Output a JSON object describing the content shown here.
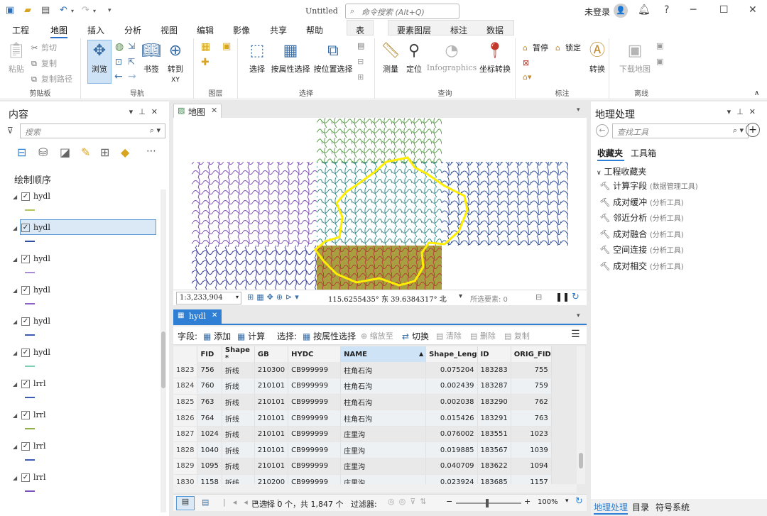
{
  "titlebar": {
    "doc_title": "Untitled",
    "search_placeholder": "命令搜索 (Alt+Q)",
    "login": "未登录",
    "avatar_glyph": "👤"
  },
  "ribbon_tabs": [
    "工程",
    "地图",
    "插入",
    "分析",
    "视图",
    "编辑",
    "影像",
    "共享",
    "帮助",
    "表",
    "要素图层",
    "标注",
    "数据"
  ],
  "ribbon": {
    "clipboard": {
      "paste": "粘贴",
      "cut": "剪切",
      "copy": "复制",
      "copy_path": "复制路径",
      "label": "剪贴板"
    },
    "navigate": {
      "explore": "浏览",
      "bookmarks": "书签",
      "goto": "转到",
      "goto_sub": "XY",
      "label": "导航"
    },
    "layer": {
      "label": "图层"
    },
    "selection": {
      "select": "选择",
      "by_attr": "按属性选择",
      "by_loc": "按位置选择",
      "label": "选择"
    },
    "inquiry": {
      "measure": "测量",
      "locate": "定位",
      "infographics": "Infographics",
      "coord": "坐标转换",
      "label": "查询"
    },
    "labeling": {
      "pause": "暂停",
      "lock": "锁定",
      "convert": "转换",
      "label": "标注"
    },
    "offline": {
      "download": "下载地图",
      "label": "离线"
    }
  },
  "contents": {
    "title": "内容",
    "search_placeholder": "搜索",
    "draw_order": "绘制顺序",
    "layers": [
      {
        "name": "hydl",
        "color": "#b5c45a",
        "selected": false
      },
      {
        "name": "hydl",
        "color": "#2e4fa0",
        "selected": true
      },
      {
        "name": "hydl",
        "color": "#a98ad4",
        "selected": false
      },
      {
        "name": "hydl",
        "color": "#8e63c9",
        "selected": false
      },
      {
        "name": "hydl",
        "color": "#3b5bb5",
        "selected": false
      },
      {
        "name": "hydl",
        "color": "#7fd0b3",
        "selected": false
      },
      {
        "name": "lrrl",
        "color": "#3b5bb5",
        "selected": false
      },
      {
        "name": "lrrl",
        "color": "#8fb04a",
        "selected": false
      },
      {
        "name": "lrrl",
        "color": "#3b5bb5",
        "selected": false
      },
      {
        "name": "lrrl",
        "color": "#7a52c0",
        "selected": false
      }
    ]
  },
  "map": {
    "tab": "地图",
    "scale": "1:3,233,904",
    "coords": "115.6255435° 东 39.6384317° 北",
    "selected_features": "所选要素: 0"
  },
  "table": {
    "tab": "hydl",
    "field_label": "字段:",
    "add": "添加",
    "calculate": "计算",
    "selection_label": "选择:",
    "select_by_attr": "按属性选择",
    "zoom_to": "缩放至",
    "switch": "切换",
    "clear": "清除",
    "delete": "删除",
    "copy": "复制",
    "columns": [
      "FID",
      "Shape *",
      "GB",
      "HYDC",
      "NAME",
      "Shape_Leng",
      "ID",
      "ORIG_FID"
    ],
    "rows": [
      [
        "1823",
        "756",
        "折线",
        "210300",
        "CB999999",
        "柱角石沟",
        "0.075204",
        "183283",
        "755"
      ],
      [
        "1824",
        "760",
        "折线",
        "210101",
        "CB999999",
        "柱角石沟",
        "0.002439",
        "183287",
        "759"
      ],
      [
        "1825",
        "763",
        "折线",
        "210101",
        "CB999999",
        "柱角石沟",
        "0.002038",
        "183290",
        "762"
      ],
      [
        "1826",
        "764",
        "折线",
        "210101",
        "CB999999",
        "柱角石沟",
        "0.015426",
        "183291",
        "763"
      ],
      [
        "1827",
        "1024",
        "折线",
        "210101",
        "CB999999",
        "庄里沟",
        "0.076002",
        "183551",
        "1023"
      ],
      [
        "1828",
        "1040",
        "折线",
        "210101",
        "CB999999",
        "庄里沟",
        "0.019885",
        "183567",
        "1039"
      ],
      [
        "1829",
        "1095",
        "折线",
        "210101",
        "CB999999",
        "庄里沟",
        "0.040709",
        "183622",
        "1094"
      ],
      [
        "1830",
        "1158",
        "折线",
        "210200",
        "CB999999",
        "庄里沟",
        "0.023924",
        "183685",
        "1157"
      ]
    ],
    "status": "已选择 0 个，共 1,847 个",
    "filter_label": "过滤器:",
    "zoom": "100%"
  },
  "geoprocessing": {
    "title": "地理处理",
    "search_placeholder": "查找工具",
    "tab_favorites": "收藏夹",
    "tab_toolboxes": "工具箱",
    "section": "工程收藏夹",
    "tools": [
      {
        "name": "计算字段",
        "box": "(数据管理工具)"
      },
      {
        "name": "成对缓冲",
        "box": "(分析工具)"
      },
      {
        "name": "邻近分析",
        "box": "(分析工具)"
      },
      {
        "name": "成对融合",
        "box": "(分析工具)"
      },
      {
        "name": "空间连接",
        "box": "(分析工具)"
      },
      {
        "name": "成对相交",
        "box": "(分析工具)"
      }
    ],
    "bottom_tabs": [
      "地理处理",
      "目录",
      "符号系统"
    ]
  }
}
